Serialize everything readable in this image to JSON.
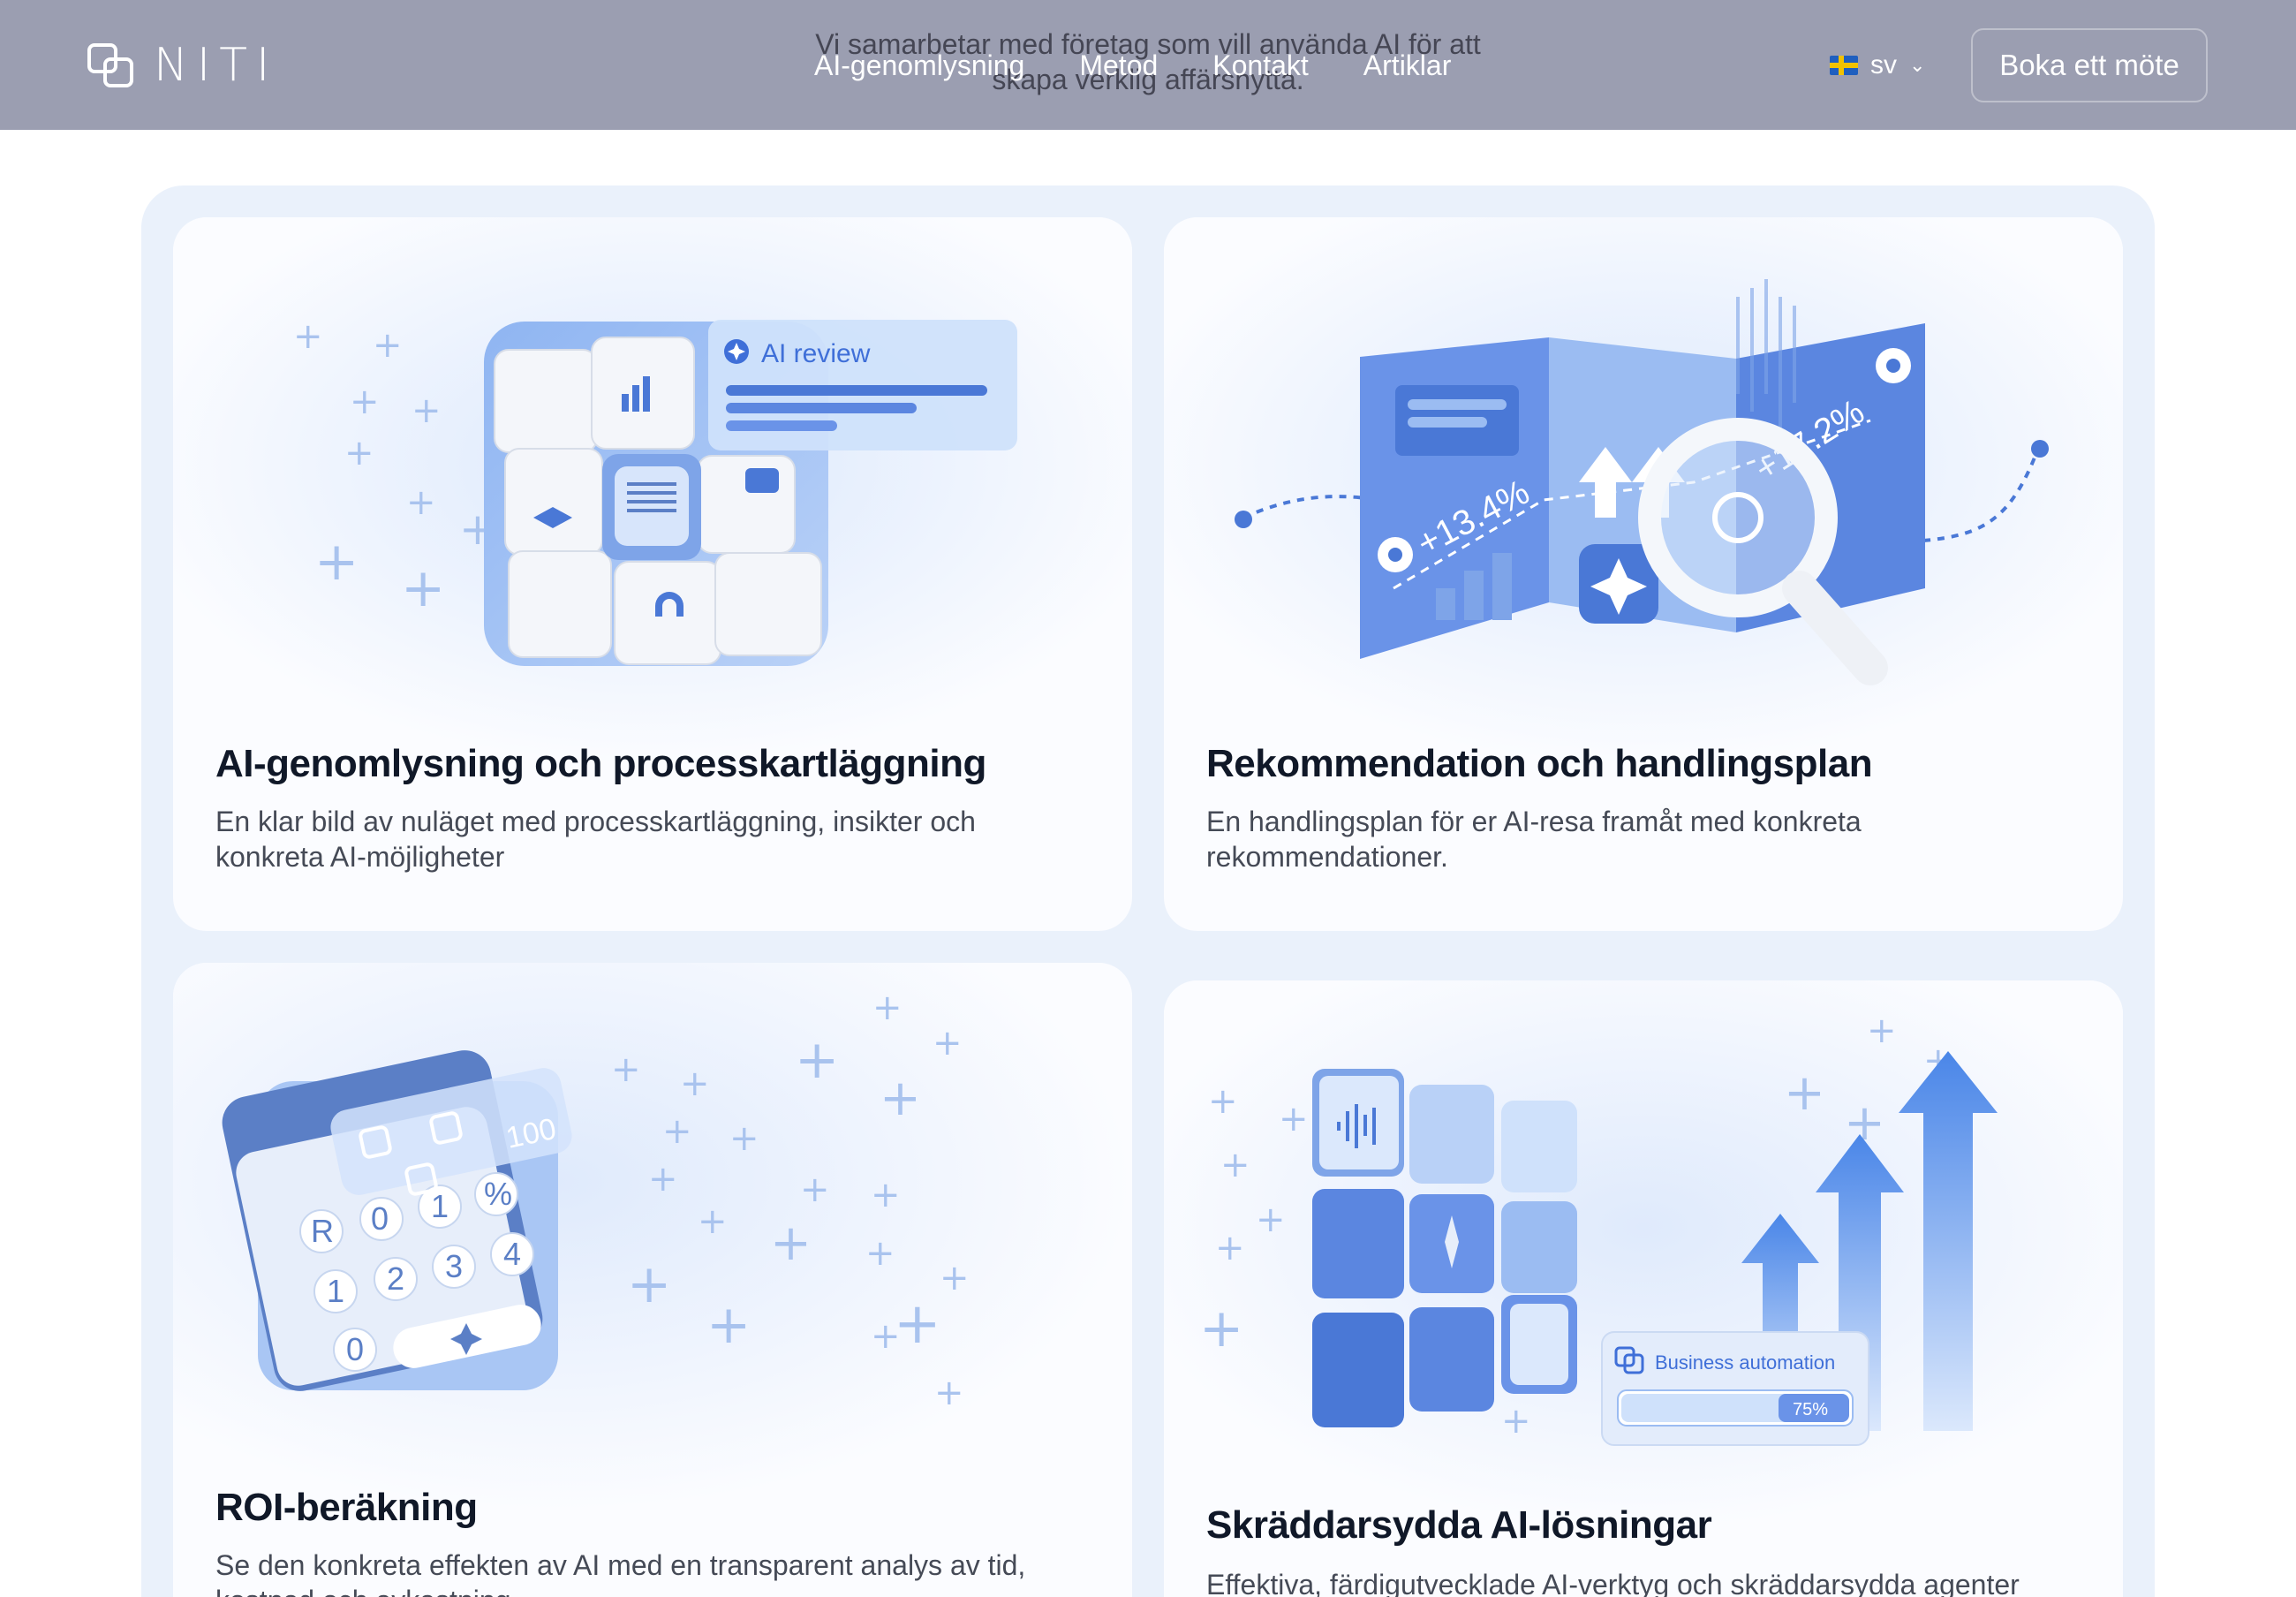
{
  "header": {
    "logo_text": "NITI",
    "tagline": "Vi samarbetar med företag som vill använda AI för att skapa verklig affärsnytta.",
    "nav": [
      "AI-genomlysning",
      "Metod",
      "Kontakt",
      "Artiklar"
    ],
    "language": "sv",
    "cta_label": "Boka ett möte"
  },
  "cards": [
    {
      "title": "AI-genomlysning och processkartläggning",
      "description": "En klar bild av nuläget med processkartläggning, insikter och konkreta AI-möjligheter",
      "illustration": {
        "badge": "AI review",
        "icon": "puzzle-icon"
      }
    },
    {
      "title": "Rekommendation och handlingsplan",
      "description": "En handlingsplan för er AI-resa framåt med konkreta rekommendationer.",
      "illustration": {
        "label_a": "+13.4%",
        "label_b": "+17.2%",
        "icon": "magnifier-icon"
      }
    },
    {
      "title": "ROI-beräkning",
      "description": "Se den konkreta effekten av AI med en transparent analys av tid, kostnad och avkastning.",
      "illustration": {
        "display_value": "100",
        "keys": [
          "R",
          "0",
          "1",
          "%",
          "1",
          "2",
          "3",
          "4",
          "0"
        ],
        "icon": "calculator-icon"
      }
    },
    {
      "title": "Skräddarsydda AI-lösningar",
      "description": "Effektiva, färdigutvecklade AI-verktyg och skräddarsydda agenter",
      "illustration": {
        "widget_label": "Business automation",
        "progress_text": "75%",
        "progress": 0.75,
        "icon": "growth-arrows-icon"
      }
    }
  ],
  "colors": {
    "header": "#9b9eb1",
    "accent": "#3f6fd8",
    "panel": "#eaf1fb"
  }
}
